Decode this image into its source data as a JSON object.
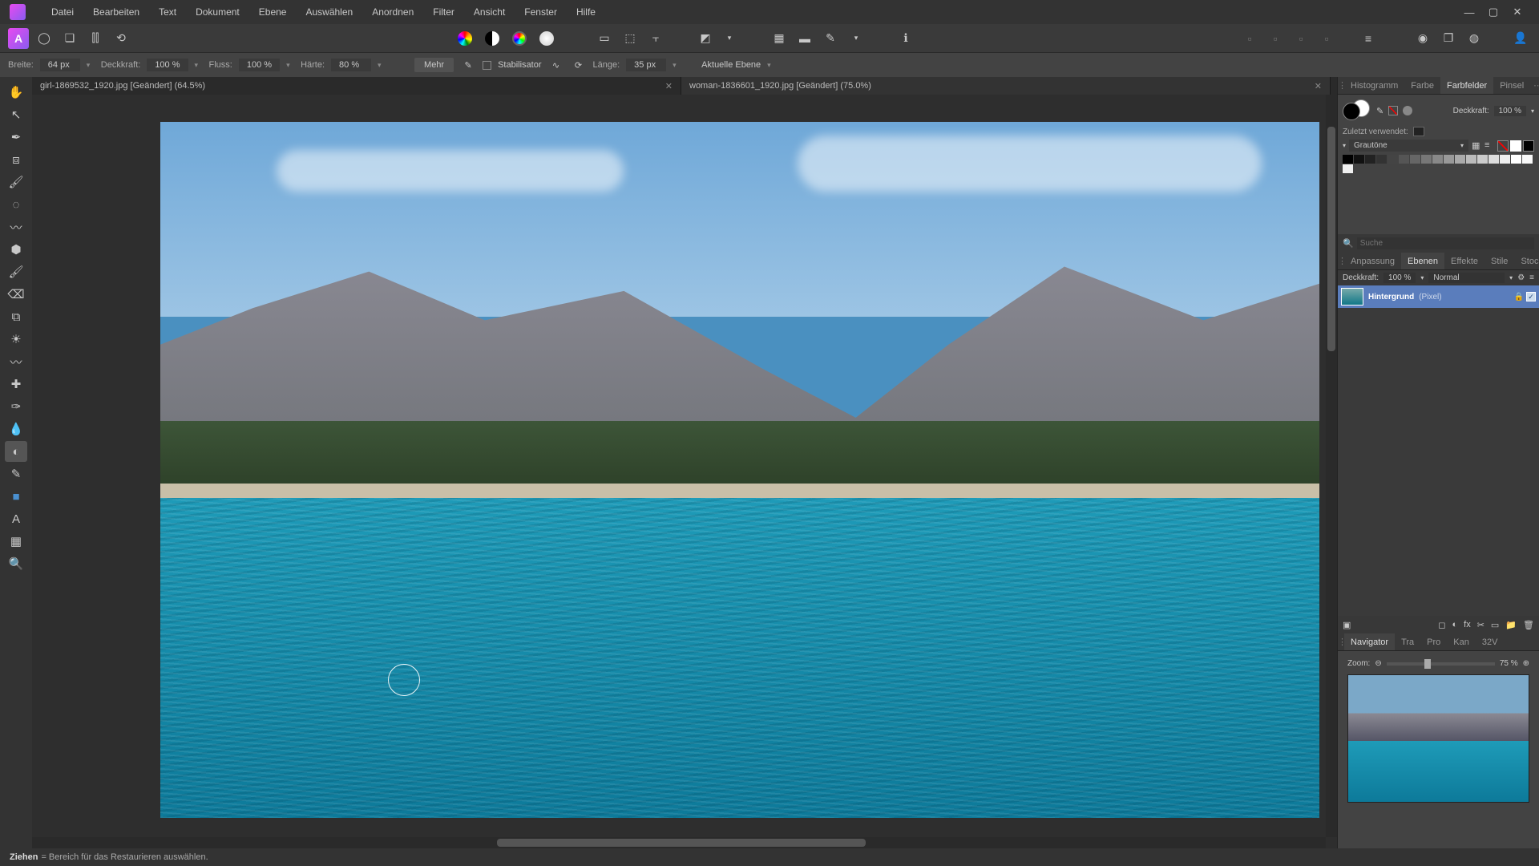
{
  "menu": {
    "items": [
      "Datei",
      "Bearbeiten",
      "Text",
      "Dokument",
      "Ebene",
      "Auswählen",
      "Anordnen",
      "Filter",
      "Ansicht",
      "Fenster",
      "Hilfe"
    ]
  },
  "context_toolbar": {
    "width_label": "Breite:",
    "width_value": "64 px",
    "opacity_label": "Deckkraft:",
    "opacity_value": "100 %",
    "flow_label": "Fluss:",
    "flow_value": "100 %",
    "hardness_label": "Härte:",
    "hardness_value": "80 %",
    "more_label": "Mehr",
    "stabilizer_label": "Stabilisator",
    "length_label": "Länge:",
    "length_value": "35 px",
    "target_label": "Aktuelle Ebene"
  },
  "tabs": [
    {
      "title": "girl-1869532_1920.jpg [Geändert] (64.5%)",
      "active": false
    },
    {
      "title": "woman-1836601_1920.jpg [Geändert] (75.0%)",
      "active": true
    }
  ],
  "right": {
    "top_tabs": [
      "Histogramm",
      "Farbe",
      "Farbfelder",
      "Pinsel"
    ],
    "top_active": "Farbfelder",
    "color": {
      "opacity_label": "Deckkraft:",
      "opacity_value": "100 %",
      "recent_label": "Zuletzt verwendet:",
      "palette_name": "Grautöne"
    },
    "mid_tabs": [
      "Anpassung",
      "Ebenen",
      "Effekte",
      "Stile",
      "Stock"
    ],
    "mid_active": "Ebenen",
    "layers": {
      "search_placeholder": "Suche",
      "opacity_label": "Deckkraft:",
      "opacity_value": "100 %",
      "blend_mode": "Normal",
      "items": [
        {
          "name": "Hintergrund",
          "type": "(Pixel)"
        }
      ]
    },
    "nav_tabs": [
      "Navigator",
      "Tra",
      "Pro",
      "Kan",
      "32V"
    ],
    "nav_active": "Navigator",
    "navigator": {
      "zoom_label": "Zoom:",
      "zoom_value": "75 %"
    }
  },
  "status": {
    "action": "Ziehen",
    "hint": "= Bereich für das Restaurieren auswählen."
  }
}
